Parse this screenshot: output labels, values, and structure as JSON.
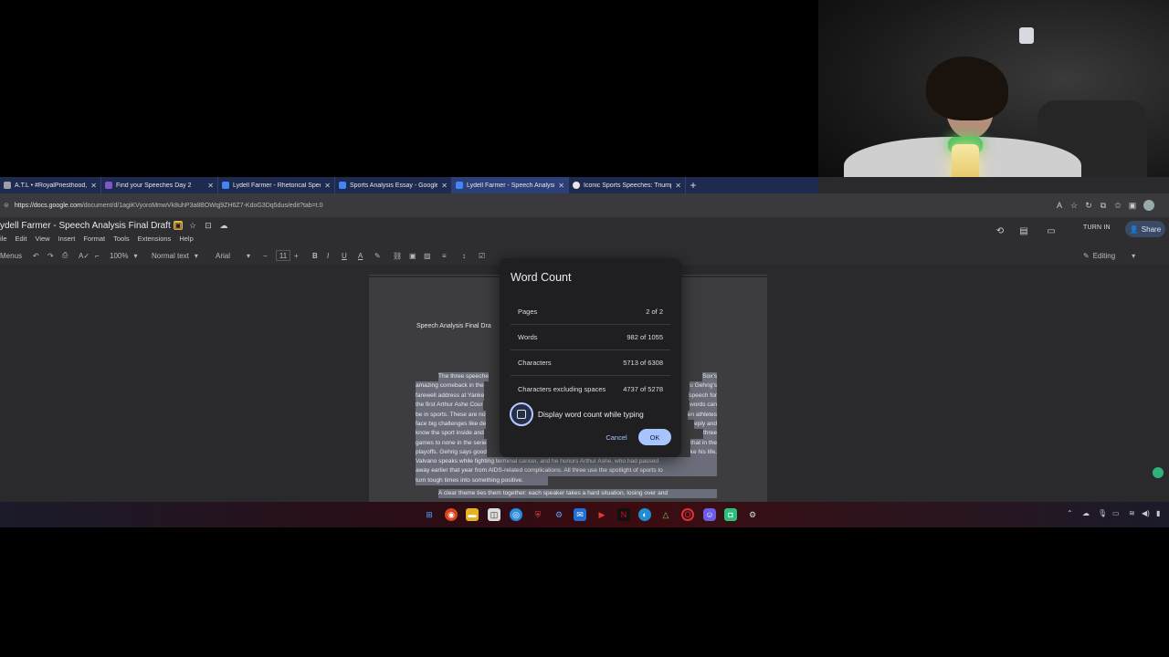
{
  "tabs": [
    {
      "label": "A.T.L • #RoyalPriesthood, D W",
      "color": "#9aa0a6"
    },
    {
      "label": "Find your Speeches Day 2",
      "color": "#7e57c2"
    },
    {
      "label": "Lydell Farmer - Rhetorical Speech",
      "color": "#4285f4"
    },
    {
      "label": "Sports Analysis Essay - Google Do",
      "color": "#4285f4"
    },
    {
      "label": "Lydell Farmer - Speech Analysis Fi",
      "color": "#4285f4"
    },
    {
      "label": "Iconic Sports Speeches: Triumph,",
      "color": "#e6e6e6"
    }
  ],
  "address": {
    "host": "https://docs.google.com",
    "path": "/document/d/1agiKVyoroMmwVk8uhP3a8BOWqj9ZH6Z7-KdoG3Dq5dus/edit?tab=t.0"
  },
  "doc": {
    "title": "ydell Farmer - Speech Analysis Final Draft",
    "menus": [
      "ile",
      "Edit",
      "View",
      "Insert",
      "Format",
      "Tools",
      "Extensions",
      "Help"
    ],
    "turn_in": "TURN IN",
    "share": "Share",
    "editing_mode": "Editing",
    "toolbar": {
      "menus": "Menus",
      "zoom": "100%",
      "style": "Normal text",
      "font": "Arial",
      "font_size": "11"
    },
    "page_title": "Speech Analysis Final Dra",
    "para1": [
      {
        "left": "The three speeche",
        "right": "Sox's"
      },
      {
        "left": "amazing comeback in the",
        "right": "u Gehrig's"
      },
      {
        "left": "farewell address at Yanke",
        "right": "speech for"
      },
      {
        "left": "the first Arthur Ashe Cour",
        "right": "words can"
      },
      {
        "left": "be in sports. These are no",
        "right": "en athletes"
      },
      {
        "left": "face big challenges like de",
        "right": "eply and"
      },
      {
        "left": "know the sport inside and",
        "right": "three"
      },
      {
        "left": "games to none in the serie",
        "right": "that in the"
      },
      {
        "left": "playoffs. Gehrig says good",
        "right": "ke his life."
      }
    ],
    "para1_full": [
      "Valvano speaks while fighting terminal cancer, and he honors Arthur Ashe, who had passed",
      "away earlier that year from AIDS-related complications. All three use the spotlight of sports to",
      "turn tough times into something positive."
    ],
    "para2": "A clear theme ties them together: each speaker takes a hard situation, losing over and"
  },
  "dialog": {
    "title": "Word Count",
    "rows": [
      {
        "label": "Pages",
        "value": "2 of 2"
      },
      {
        "label": "Words",
        "value": "982 of 1055"
      },
      {
        "label": "Characters",
        "value": "5713 of 6308"
      },
      {
        "label": "Characters excluding spaces",
        "value": "4737 of 5278"
      }
    ],
    "checkbox_label": "Display word count while typing",
    "cancel": "Cancel",
    "ok": "OK"
  },
  "accent": "#a8c4ff"
}
